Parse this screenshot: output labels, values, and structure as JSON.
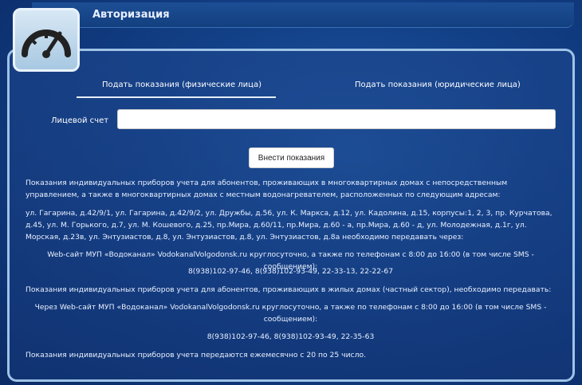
{
  "header": {
    "title": "Авторизация"
  },
  "tabs": [
    {
      "label": "Подать показания (физические лица)"
    },
    {
      "label": "Подать показания (юридические лица)"
    }
  ],
  "form": {
    "account_label": "Лицевой счет",
    "account_value": "",
    "submit_label": "Внести показания"
  },
  "info": {
    "p1": "Показания индивидуальных приборов учета для абонентов, проживающих в многоквартирных домах с непосредственным управлением, а также в многоквартирных домах с местным водонагревателем, расположенных по следующим адресам:",
    "p2": "ул. Гагарина, д.42/9/1, ул. Гагарина, д.42/9/2, ул. Дружбы, д.56, ул. К. Маркса, д.12, ул. Кадолина, д.15, корпусы:1, 2, 3, пр. Курчатова, д.45, ул. М. Горького, д.7, ул. М. Кошевого, д.25, пр.Мира, д.60/11, пр.Мира, д.60 - а, пр.Мира, д.60 - д, ул. Молодежная, д.1г, ул. Морская, д.23в, ул. Энтузиастов, д.8, ул. Энтузиастов, д.8, ул. Энтузиастов, д.8а необходимо передавать через:",
    "p3": "Web-сайт МУП «Водоканал» VodokanalVolgodonsk.ru круглосуточно,  а также по телефонам с 8:00 до 16:00 (в том числе SMS - сообщением):",
    "p4": "8(938)102-97-46, 8(938)102-93-49, 22-33-13, 22-22-67",
    "p5": "Показания индивидуальных приборов учета для абонентов, проживающих в жилых домах (частный сектор), необходимо передавать:",
    "p6": "Через Web-сайт МУП «Водоканал» VodokanalVolgodonsk.ru круглосуточно,  а также по телефонам с 8:00 до 16:00 (в том числе SMS - сообщением):",
    "p7": "8(938)102-97-46, 8(938)102-93-49, 22-35-63",
    "p8": "Показания индивидуальных приборов учета передаются ежемесячно с 20 по 25 число."
  },
  "icons": {
    "logo": "gauge-icon"
  }
}
